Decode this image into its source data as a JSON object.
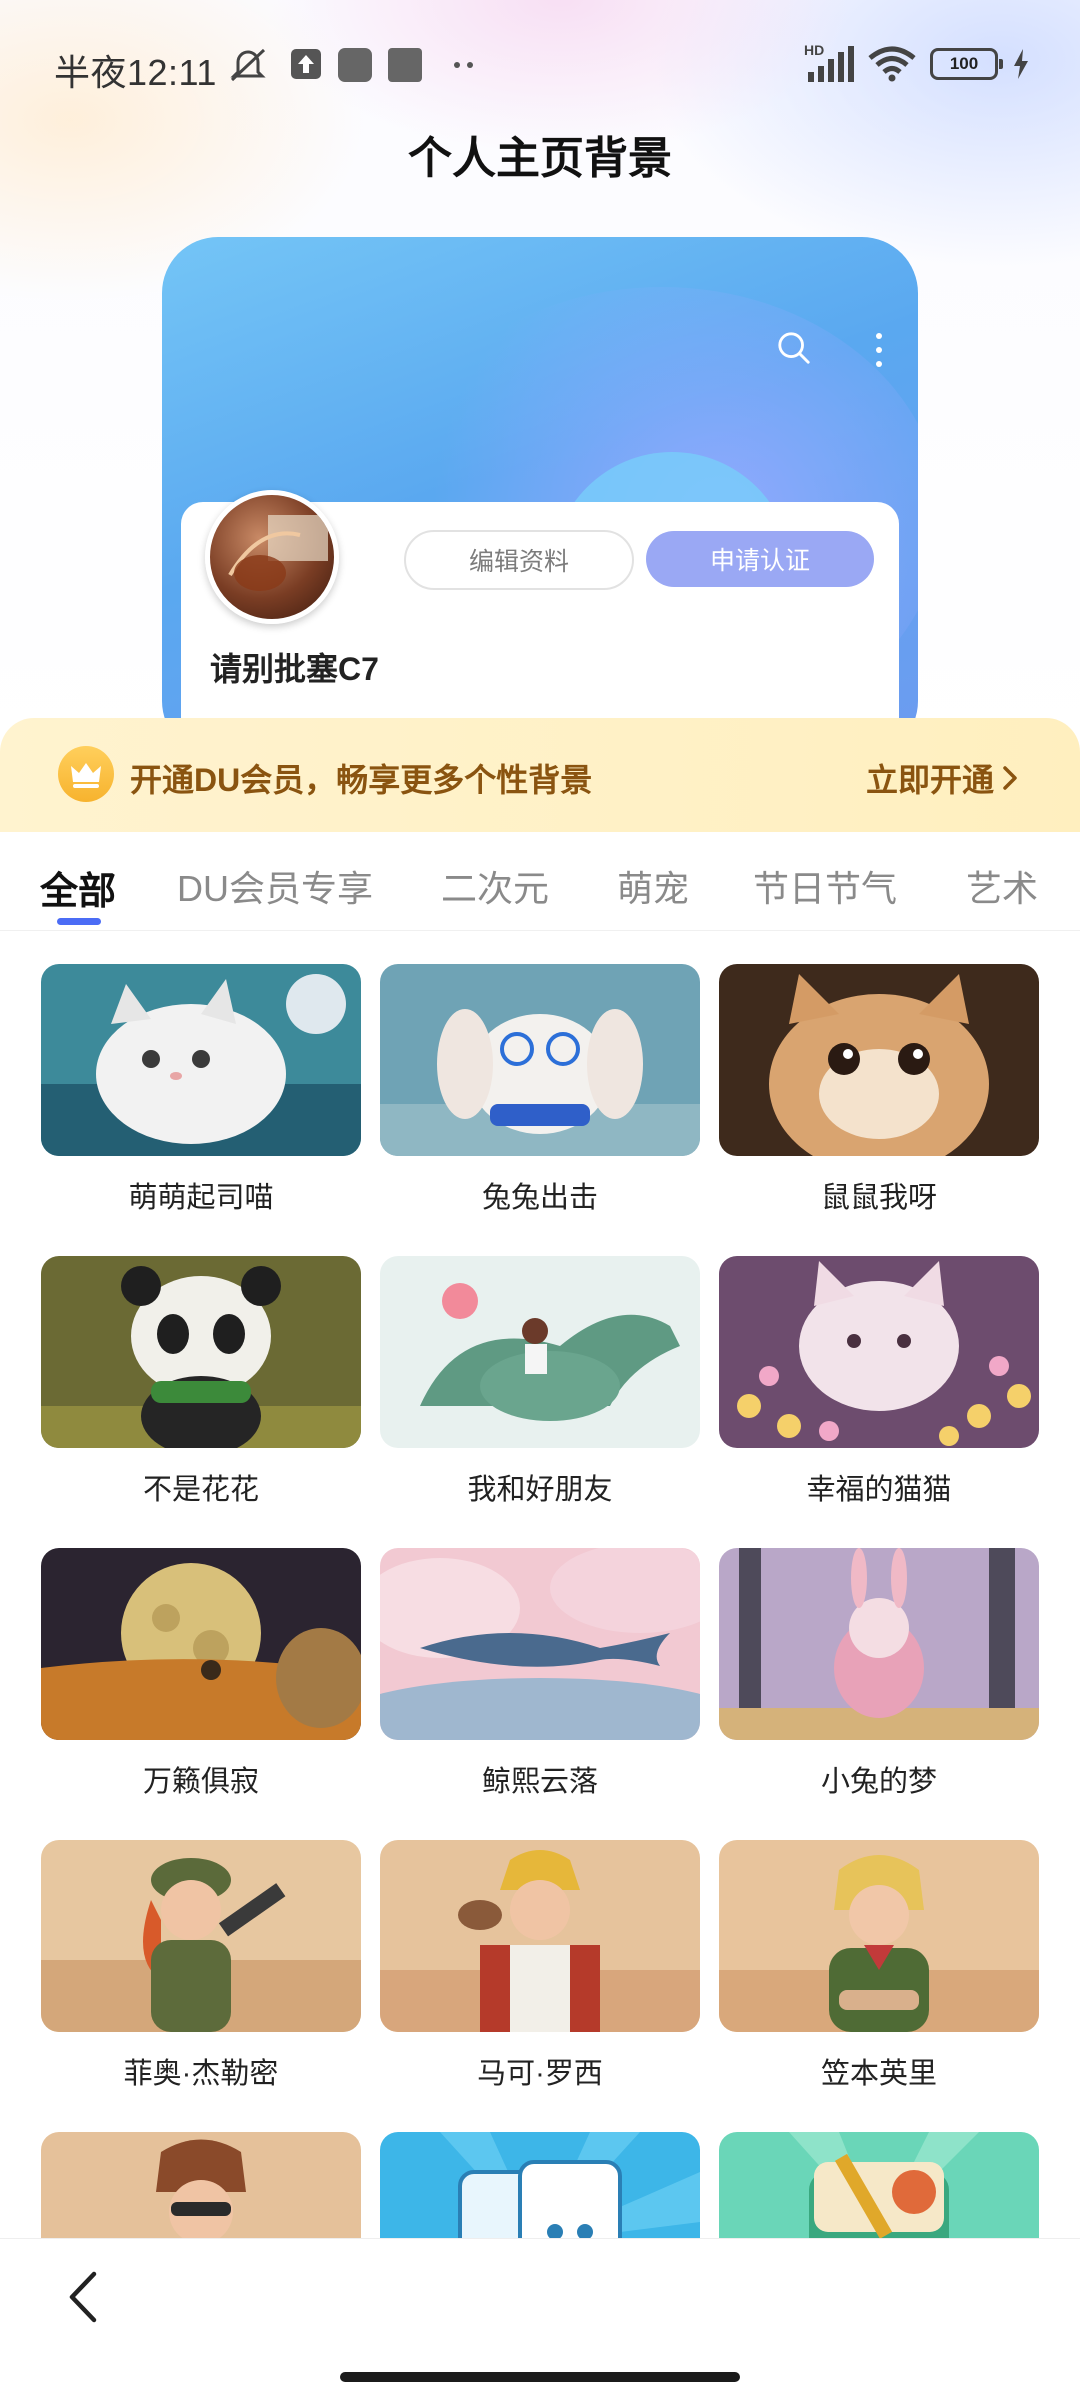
{
  "status_bar": {
    "time": "半夜12:11",
    "battery": "100",
    "network": "HD"
  },
  "header": {
    "title": "个人主页背景"
  },
  "preview": {
    "edit_label": "编辑资料",
    "verify_label": "申请认证",
    "username": "请别批塞C7"
  },
  "vip_banner": {
    "text": "开通DU会员，畅享更多个性背景",
    "action": "立即开通"
  },
  "tabs": [
    {
      "label": "全部"
    },
    {
      "label": "DU会员专享"
    },
    {
      "label": "二次元"
    },
    {
      "label": "萌宠"
    },
    {
      "label": "节日节气"
    },
    {
      "label": "艺术"
    }
  ],
  "grid": [
    {
      "label": "萌萌起司喵"
    },
    {
      "label": "兔兔出击"
    },
    {
      "label": "鼠鼠我呀"
    },
    {
      "label": "不是花花"
    },
    {
      "label": "我和好朋友"
    },
    {
      "label": "幸福的猫猫"
    },
    {
      "label": "万籁俱寂"
    },
    {
      "label": "鲸熙云落"
    },
    {
      "label": "小兔的梦"
    },
    {
      "label": "菲奥·杰勒密"
    },
    {
      "label": "马可·罗西"
    },
    {
      "label": "笠本英里"
    }
  ],
  "colors": {
    "accent": "#4b6cf5",
    "verify_button": "#9aa8f4",
    "vip_text": "#8a5410",
    "vip_bg": "#fff3cf"
  }
}
